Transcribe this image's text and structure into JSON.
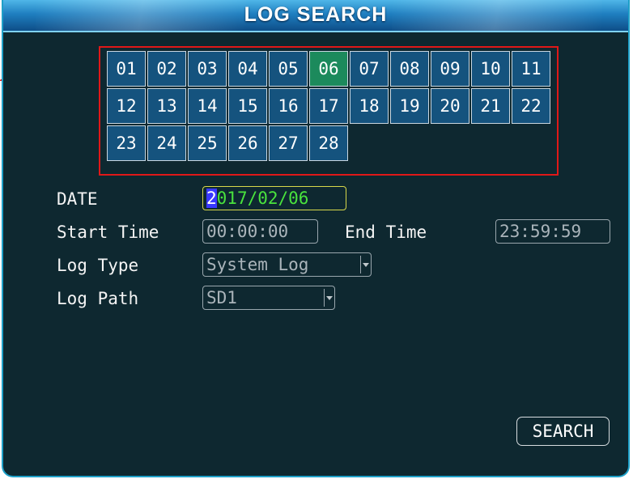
{
  "title": "LOG SEARCH",
  "calendar": {
    "days": [
      "01",
      "02",
      "03",
      "04",
      "05",
      "06",
      "07",
      "08",
      "09",
      "10",
      "11",
      "12",
      "13",
      "14",
      "15",
      "16",
      "17",
      "18",
      "19",
      "20",
      "21",
      "22",
      "23",
      "24",
      "25",
      "26",
      "27",
      "28"
    ],
    "selected_day": "06"
  },
  "form": {
    "date_label": "DATE",
    "date_value_cursor": "2",
    "date_value_rest": "017/02/06",
    "start_time_label": "Start Time",
    "start_time_value": "00:00:00",
    "end_time_label": "End Time",
    "end_time_value": "23:59:59",
    "log_type_label": "Log Type",
    "log_type_value": "System Log",
    "log_path_label": "Log Path",
    "log_path_value": "SD1"
  },
  "search_button": "SEARCH",
  "colors": {
    "background": "#0e2830",
    "cell": "#15537e",
    "selected_cell": "#1c8a5c",
    "highlight_frame": "#e01818",
    "date_text": "#49e33d"
  }
}
